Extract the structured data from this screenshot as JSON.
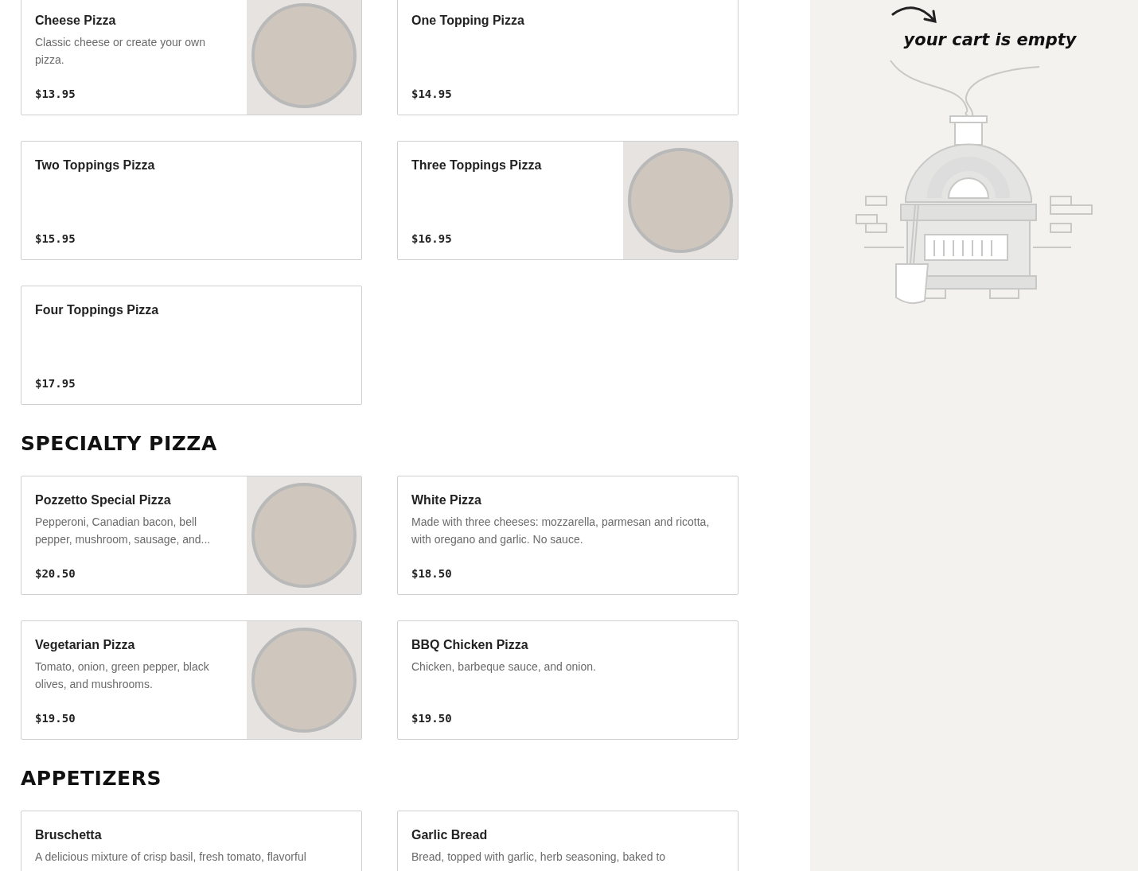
{
  "sections": [
    {
      "items": [
        {
          "name": "Cheese Pizza",
          "description": "Classic cheese or create your own pizza.",
          "price": "$13.95",
          "has_photo": true
        },
        {
          "name": "One Topping Pizza",
          "price": "$14.95",
          "has_photo": false
        },
        {
          "name": "Two Toppings Pizza",
          "price": "$15.95",
          "has_photo": false
        },
        {
          "name": "Three Toppings Pizza",
          "price": "$16.95",
          "has_photo": true
        },
        {
          "name": "Four Toppings Pizza",
          "price": "$17.95",
          "has_photo": false
        }
      ]
    },
    {
      "heading": "SPECIALTY PIZZA",
      "items": [
        {
          "name": "Pozzetto Special Pizza",
          "description": "Pepperoni, Canadian bacon, bell pepper, mushroom, sausage, and...",
          "price": "$20.50",
          "has_photo": true
        },
        {
          "name": "White Pizza",
          "description": "Made with three cheeses: mozzarella, parmesan and ricotta, with oregano and garlic. No sauce.",
          "price": "$18.50",
          "has_photo": false
        },
        {
          "name": "Vegetarian Pizza",
          "description": "Tomato, onion, green pepper, black olives, and mushrooms.",
          "price": "$19.50",
          "has_photo": true
        },
        {
          "name": "BBQ Chicken Pizza",
          "description": "Chicken, barbeque sauce, and onion.",
          "price": "$19.50",
          "has_photo": false
        }
      ]
    },
    {
      "heading": "APPETIZERS",
      "items": [
        {
          "name": "Bruschetta",
          "description": "A delicious mixture of crisp basil, fresh tomato, flavorful",
          "has_photo": false
        },
        {
          "name": "Garlic Bread",
          "description": "Bread, topped with garlic, herb seasoning, baked to",
          "has_photo": false
        }
      ]
    }
  ],
  "cart": {
    "message": "your cart is empty"
  }
}
